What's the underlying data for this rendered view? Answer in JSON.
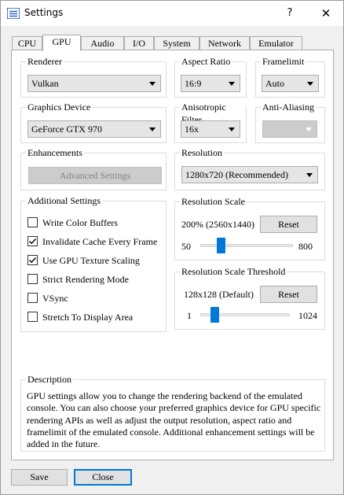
{
  "window": {
    "title": "Settings",
    "help_glyph": "?",
    "close_glyph": "✕",
    "icon": "settings-app-icon"
  },
  "tabs": [
    {
      "label": "CPU"
    },
    {
      "label": "GPU",
      "active": true
    },
    {
      "label": "Audio"
    },
    {
      "label": "I/O"
    },
    {
      "label": "System"
    },
    {
      "label": "Network"
    },
    {
      "label": "Emulator"
    }
  ],
  "renderer": {
    "title": "Renderer",
    "value": "Vulkan"
  },
  "aspect_ratio": {
    "title": "Aspect Ratio",
    "value": "16:9"
  },
  "framelimit": {
    "title": "Framelimit",
    "value": "Auto"
  },
  "graphics_device": {
    "title": "Graphics Device",
    "value": "GeForce GTX 970"
  },
  "anisotropic_filter": {
    "title": "Anisotropic Filter",
    "value": "16x"
  },
  "anti_aliasing": {
    "title": "Anti-Aliasing",
    "value": "",
    "disabled": true
  },
  "enhancements": {
    "title": "Enhancements",
    "advanced_button": "Advanced Settings"
  },
  "resolution": {
    "title": "Resolution",
    "value": "1280x720 (Recommended)"
  },
  "additional_settings": {
    "title": "Additional Settings",
    "items": [
      {
        "label": "Write Color Buffers",
        "checked": false
      },
      {
        "label": "Invalidate Cache Every Frame",
        "checked": true
      },
      {
        "label": "Use GPU Texture Scaling",
        "checked": true
      },
      {
        "label": "Strict Rendering Mode",
        "checked": false
      },
      {
        "label": "VSync",
        "checked": false
      },
      {
        "label": "Stretch To Display Area",
        "checked": false
      }
    ]
  },
  "resolution_scale": {
    "title": "Resolution Scale",
    "value_label": "200% (2560x1440)",
    "reset_label": "Reset",
    "min_label": "50",
    "max_label": "800",
    "min": 50,
    "max": 800,
    "value": 200
  },
  "resolution_scale_threshold": {
    "title": "Resolution Scale Threshold",
    "value_label": "128x128 (Default)",
    "reset_label": "Reset",
    "min_label": "1",
    "max_label": "1024",
    "min": 1,
    "max": 1024,
    "value": 128
  },
  "description": {
    "title": "Description",
    "text": "GPU settings allow you to change the rendering backend of the emulated console. You can also choose your preferred graphics device for GPU specific rendering APIs as well as adjust the output resolution, aspect ratio and framelimit of the emulated console. Additional enhancement settings will be added in the future."
  },
  "footer": {
    "save_label": "Save",
    "close_label": "Close"
  },
  "colors": {
    "accent": "#0078d7",
    "panel": "#ffffff",
    "window": "#f0f0f0"
  }
}
